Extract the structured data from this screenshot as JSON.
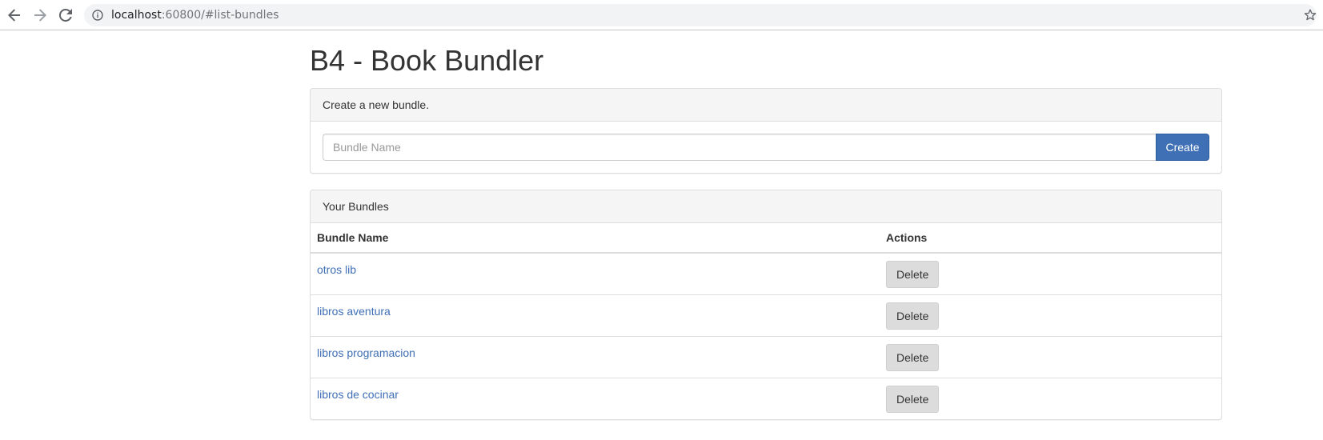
{
  "browser": {
    "url_host": "localhost",
    "url_rest": ":60800/#list-bundles"
  },
  "page": {
    "title": "B4 - Book Bundler"
  },
  "create_panel": {
    "heading": "Create a new bundle.",
    "input_placeholder": "Bundle Name",
    "input_value": "",
    "create_label": "Create"
  },
  "bundles_panel": {
    "heading": "Your Bundles",
    "columns": [
      "Bundle Name",
      "Actions"
    ],
    "rows": [
      {
        "name": "otros lib",
        "action": "Delete"
      },
      {
        "name": "libros aventura",
        "action": "Delete"
      },
      {
        "name": "libros programacion",
        "action": "Delete"
      },
      {
        "name": "libros de cocinar",
        "action": "Delete"
      }
    ]
  },
  "icons": {
    "back": "back-arrow-icon",
    "forward": "forward-arrow-icon",
    "reload": "reload-icon",
    "info": "info-icon",
    "bookmark": "star-icon"
  },
  "colors": {
    "primary": "#3f6fb5",
    "link": "#3f6fb5",
    "delete_button": "#dcdcdc"
  }
}
